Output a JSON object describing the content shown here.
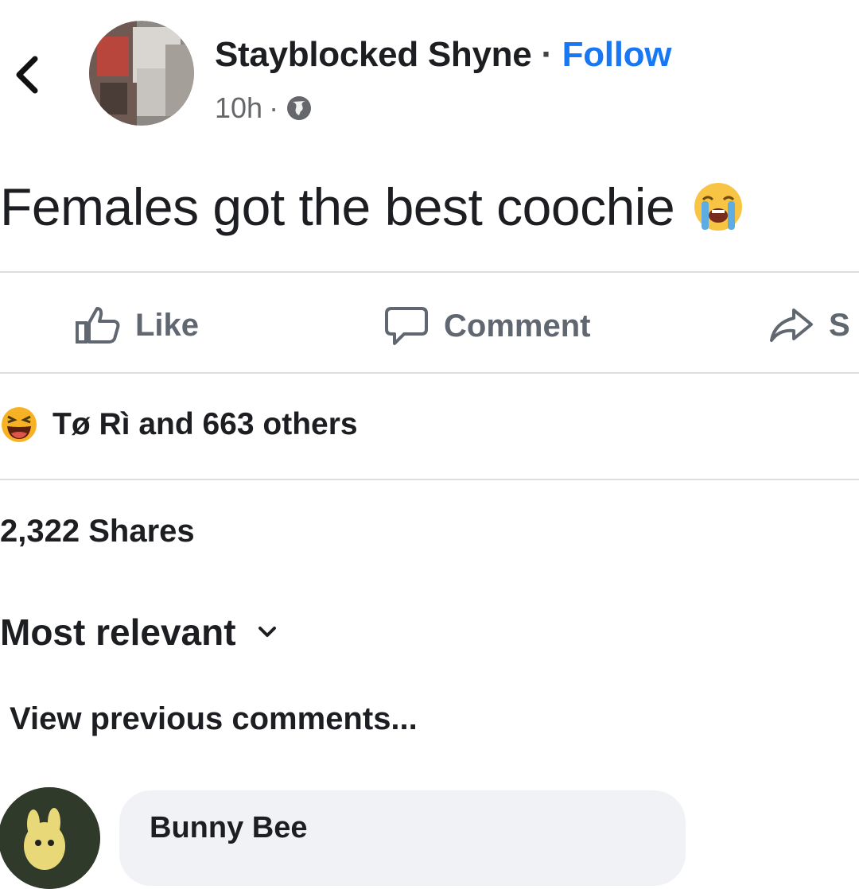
{
  "header": {
    "author_name": "Stayblocked Shyne",
    "separator": "·",
    "follow_label": "Follow",
    "time": "10h",
    "meta_separator": "·",
    "privacy_icon": "globe-icon",
    "back_icon": "chevron-left-icon"
  },
  "post": {
    "text": "Females got the best coochie",
    "emoji_icon": "loudly-crying-face-icon"
  },
  "actions": {
    "like_label": "Like",
    "comment_label": "Comment",
    "share_label": "S"
  },
  "reactions": {
    "icon": "laughing-face-icon",
    "summary": "Tø Rì and 663 others"
  },
  "shares": {
    "label": "2,322 Shares"
  },
  "comments": {
    "sort_label": "Most relevant",
    "view_previous_label": "View previous comments...",
    "items": [
      {
        "author": "Bunny Bee"
      }
    ]
  },
  "colors": {
    "link_blue": "#1877f2",
    "muted_text": "#65676b",
    "action_gray": "#606770",
    "divider": "#dcdde0",
    "bubble_bg": "#f0f2f5",
    "reaction_yellow": "#f7b125"
  }
}
